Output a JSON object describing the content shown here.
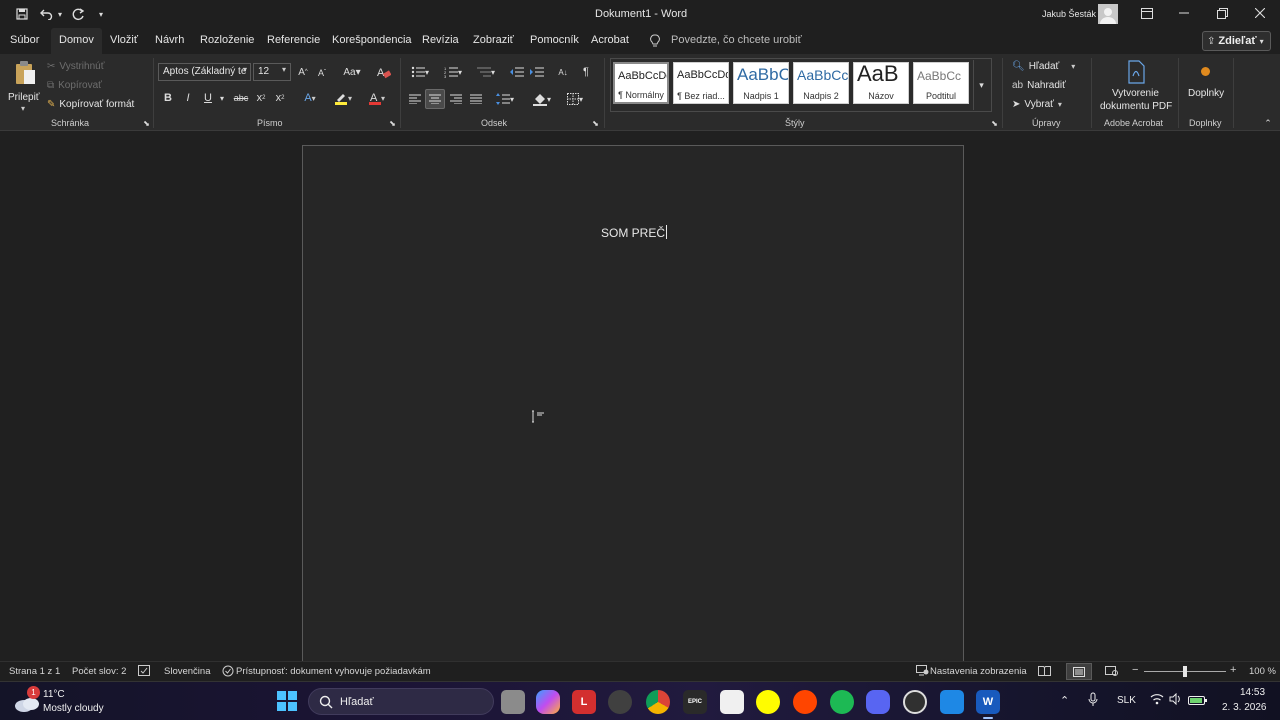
{
  "titlebar": {
    "doc_title": "Dokument1 - Word",
    "user_name": "Jakub Šesták"
  },
  "menu": {
    "items": [
      "Súbor",
      "Domov",
      "Vložiť",
      "Návrh",
      "Rozloženie",
      "Referencie",
      "Korešpondencia",
      "Revízia",
      "Zobraziť",
      "Pomocník",
      "Acrobat"
    ],
    "search_placeholder": "Povedzte, čo chcete urobiť",
    "share_label": "Zdieľať"
  },
  "ribbon": {
    "clipboard": {
      "paste": "Prilepiť",
      "cut": "Vystrihnúť",
      "copy": "Kopírovať",
      "format_painter": "Kopírovať formát",
      "group_label": "Schránka"
    },
    "font": {
      "font_name": "Aptos (Základný te",
      "font_size": "12",
      "group_label": "Písmo"
    },
    "paragraph": {
      "group_label": "Odsek"
    },
    "styles": {
      "items": [
        {
          "sample": "AaBbCcDd",
          "name": "¶ Normálny"
        },
        {
          "sample": "AaBbCcDd",
          "name": "¶ Bez riad..."
        },
        {
          "sample": "AaBbC",
          "name": "Nadpis 1"
        },
        {
          "sample": "AaBbCc",
          "name": "Nadpis 2"
        },
        {
          "sample": "AaB",
          "name": "Názov"
        },
        {
          "sample": "AaBbCc",
          "name": "Podtitul"
        }
      ],
      "group_label": "Štýly"
    },
    "editing": {
      "find": "Hľadať",
      "replace": "Nahradiť",
      "select": "Vybrať",
      "group_label": "Úpravy"
    },
    "acrobat": {
      "create_pdf_line1": "Vytvorenie",
      "create_pdf_line2": "dokumentu PDF",
      "group_label": "Adobe Acrobat"
    },
    "addins": {
      "label": "Doplnky",
      "group_label": "Doplnky"
    }
  },
  "document": {
    "text": "SOM PREČ"
  },
  "status": {
    "page": "Strana 1 z 1",
    "words": "Počet slov: 2",
    "language": "Slovenčina",
    "accessibility": "Prístupnosť: dokument vyhovuje požiadavkám",
    "display_settings": "Nastavenia zobrazenia",
    "zoom": "100 %"
  },
  "taskbar": {
    "weather_temp": "11°C",
    "weather_desc": "Mostly cloudy",
    "weather_badge": "1",
    "search_label": "Hľadať",
    "language": "SLK",
    "time": "14:53",
    "date": "2. 3. 2026"
  }
}
